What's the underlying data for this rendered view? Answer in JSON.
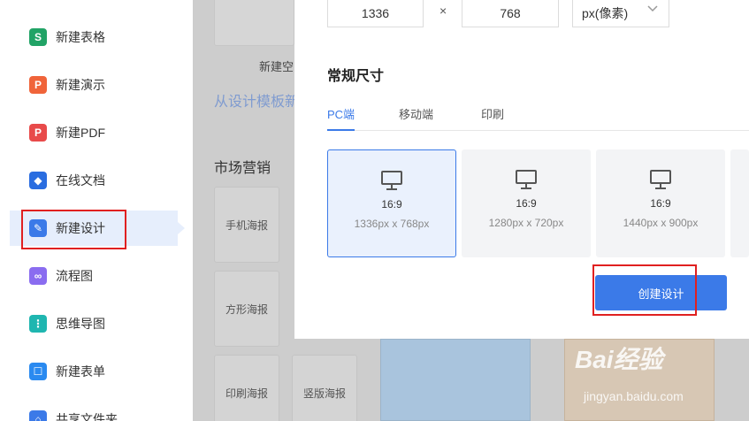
{
  "sidebar": {
    "items": [
      {
        "label": "新建表格",
        "icon": "spreadsheet-icon",
        "glyph": "S",
        "color": "#21a366"
      },
      {
        "label": "新建演示",
        "icon": "presentation-icon",
        "glyph": "P",
        "color": "#f0643a"
      },
      {
        "label": "新建PDF",
        "icon": "pdf-icon",
        "glyph": "P",
        "color": "#e84a4a"
      },
      {
        "label": "在线文档",
        "icon": "online-doc-icon",
        "glyph": "◆",
        "color": "#2a6de0"
      },
      {
        "label": "新建设计",
        "icon": "design-icon",
        "glyph": "✎",
        "color": "#3b7ae8"
      },
      {
        "label": "流程图",
        "icon": "flowchart-icon",
        "glyph": "∞",
        "color": "#8a6cf0"
      },
      {
        "label": "思维导图",
        "icon": "mindmap-icon",
        "glyph": "⋮",
        "color": "#1fb6b0"
      },
      {
        "label": "新建表单",
        "icon": "form-icon",
        "glyph": "☐",
        "color": "#2a8af0"
      },
      {
        "label": "共享文件夹",
        "icon": "shared-folder-icon",
        "glyph": "⌂",
        "color": "#3b7ae8"
      }
    ]
  },
  "background": {
    "blank_label": "新建空白",
    "template_link": "从设计模板新",
    "category_title": "市场营销",
    "templates": [
      "手机海报",
      "方形海报",
      "印刷海报",
      "竖版海报"
    ]
  },
  "modal": {
    "width_value": "1336",
    "times": "×",
    "height_value": "768",
    "unit": "px(像素)",
    "section_title": "常规尺寸",
    "tabs": [
      "PC端",
      "移动端",
      "印刷"
    ],
    "sizes": [
      {
        "ratio": "16:9",
        "dims": "1336px x 768px"
      },
      {
        "ratio": "16:9",
        "dims": "1280px x 720px"
      },
      {
        "ratio": "16:9",
        "dims": "1440px x 900px"
      }
    ],
    "create_button": "创建设计"
  },
  "watermark": {
    "logo": "Bai经验",
    "url": "jingyan.baidu.com"
  },
  "colors": {
    "accent": "#3b7ae8",
    "highlight_box": "#e02020"
  }
}
